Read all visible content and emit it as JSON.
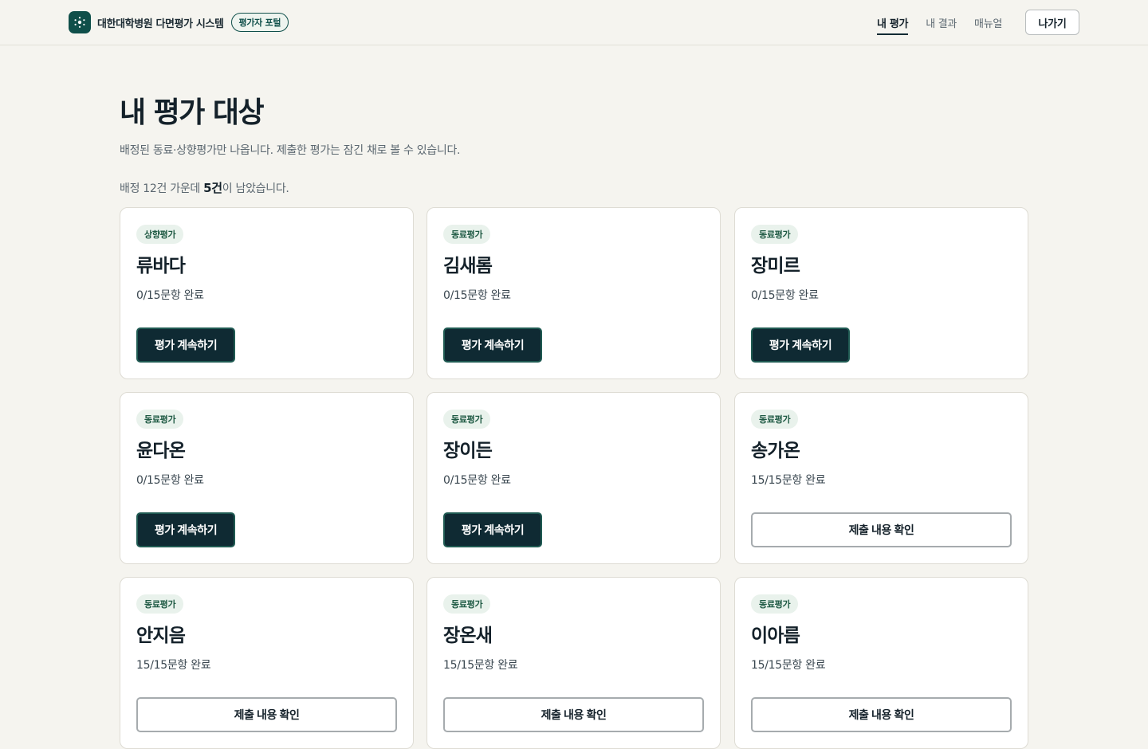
{
  "header": {
    "brand_title": "대한대학병원 다면평가 시스템",
    "portal_badge": "평가자 포털",
    "nav": [
      {
        "label": "내 평가",
        "active": true
      },
      {
        "label": "내 결과",
        "active": false
      },
      {
        "label": "매뉴얼",
        "active": false
      }
    ],
    "exit_label": "나가기"
  },
  "main": {
    "title": "내 평가 대상",
    "description": "배정된 동료·상향평가만 나옵니다. 제출한 평가는 잠긴 채로 볼 수 있습니다.",
    "summary_prefix": "배정 12건 가운데 ",
    "summary_remaining": "5건",
    "summary_suffix": "이 남았습니다."
  },
  "cards": [
    {
      "type": "상향평가",
      "name": "류바다",
      "progress": "0/15문항 완료",
      "action": "평가 계속하기",
      "submitted": false
    },
    {
      "type": "동료평가",
      "name": "김새롬",
      "progress": "0/15문항 완료",
      "action": "평가 계속하기",
      "submitted": false
    },
    {
      "type": "동료평가",
      "name": "장미르",
      "progress": "0/15문항 완료",
      "action": "평가 계속하기",
      "submitted": false
    },
    {
      "type": "동료평가",
      "name": "윤다온",
      "progress": "0/15문항 완료",
      "action": "평가 계속하기",
      "submitted": false
    },
    {
      "type": "동료평가",
      "name": "장이든",
      "progress": "0/15문항 완료",
      "action": "평가 계속하기",
      "submitted": false
    },
    {
      "type": "동료평가",
      "name": "송가온",
      "progress": "15/15문항 완료",
      "action": "제출 내용 확인",
      "submitted": true
    },
    {
      "type": "동료평가",
      "name": "안지음",
      "progress": "15/15문항 완료",
      "action": "제출 내용 확인",
      "submitted": true
    },
    {
      "type": "동료평가",
      "name": "장온새",
      "progress": "15/15문항 완료",
      "action": "제출 내용 확인",
      "submitted": true
    },
    {
      "type": "동료평가",
      "name": "이아름",
      "progress": "15/15문항 완료",
      "action": "제출 내용 확인",
      "submitted": true
    }
  ],
  "icons": {
    "logo": "molecule-logo-icon"
  },
  "colors": {
    "brand": "#0f4f4a",
    "primary_button": "#0f2a33",
    "background": "#f5f4ef"
  }
}
